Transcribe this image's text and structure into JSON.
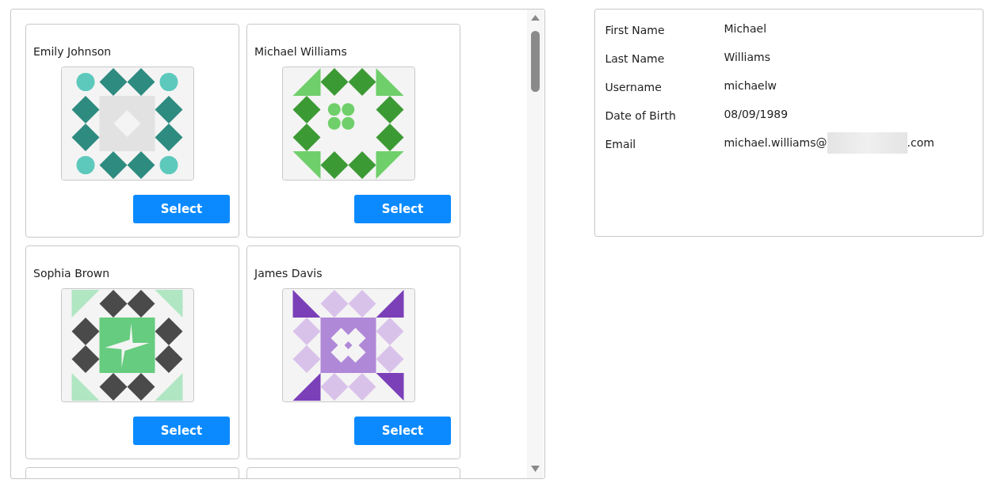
{
  "users": [
    {
      "kind": "card",
      "name": "Emily Johnson",
      "button": "Select"
    },
    {
      "kind": "card",
      "name": "Michael Williams",
      "button": "Select"
    },
    {
      "kind": "card",
      "name": "Sophia Brown",
      "button": "Select"
    },
    {
      "kind": "card",
      "name": "James Davis",
      "button": "Select"
    },
    {
      "kind": "clipped"
    },
    {
      "kind": "clipped"
    }
  ],
  "details": [
    {
      "label": "First Name",
      "value": "Michael"
    },
    {
      "label": "Last Name",
      "value": "Williams"
    },
    {
      "label": "Username",
      "value": "michaelw"
    },
    {
      "label": "Date of Birth",
      "value": "08/09/1989"
    },
    {
      "label": "Email",
      "kind": "redacted",
      "value": "michael.williams@",
      "value_end": ".com"
    }
  ]
}
